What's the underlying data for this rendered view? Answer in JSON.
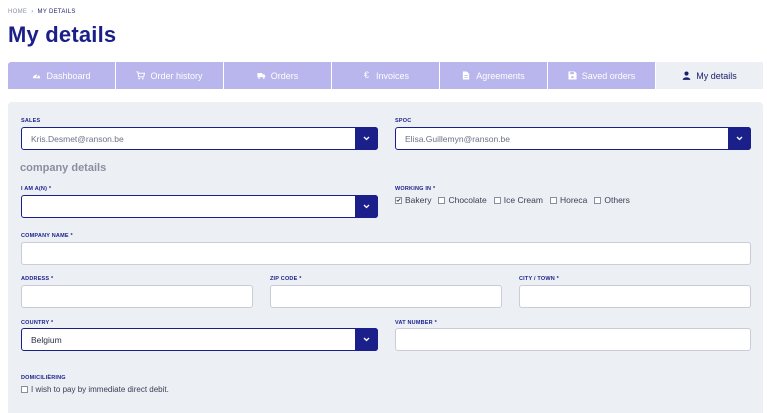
{
  "breadcrumb": {
    "home": "HOME",
    "separator": "›",
    "current": "MY DETAILS"
  },
  "page": {
    "title": "My details"
  },
  "tabs": [
    {
      "label": "Dashboard",
      "icon": "dashboard-icon"
    },
    {
      "label": "Order history",
      "icon": "cart-icon"
    },
    {
      "label": "Orders",
      "icon": "truck-icon"
    },
    {
      "label": "Invoices",
      "icon": "euro-icon"
    },
    {
      "label": "Agreements",
      "icon": "document-icon"
    },
    {
      "label": "Saved orders",
      "icon": "save-icon"
    },
    {
      "label": "My details",
      "icon": "user-icon",
      "active": true
    }
  ],
  "form": {
    "sales": {
      "label": "SALES",
      "value": "Kris.Desmet@ranson.be"
    },
    "spoc": {
      "label": "SPOC",
      "value": "Elisa.Guillemyn@ranson.be"
    },
    "section_title": "company details",
    "i_am": {
      "label": "I AM A(N) *",
      "value": ""
    },
    "working_in": {
      "label": "WORKING IN *",
      "options": [
        {
          "label": "Bakery",
          "checked": true
        },
        {
          "label": "Chocolate",
          "checked": false
        },
        {
          "label": "Ice Cream",
          "checked": false
        },
        {
          "label": "Horeca",
          "checked": false
        },
        {
          "label": "Others",
          "checked": false
        }
      ]
    },
    "company_name": {
      "label": "COMPANY NAME *",
      "value": ""
    },
    "address": {
      "label": "ADDRESS *",
      "value": ""
    },
    "zip_code": {
      "label": "ZIP CODE *",
      "value": ""
    },
    "city": {
      "label": "CITY / TOWN *",
      "value": ""
    },
    "country": {
      "label": "COUNTRY *",
      "value": "Belgium"
    },
    "vat_number": {
      "label": "VAT NUMBER *",
      "value": ""
    },
    "domiciliering": {
      "label": "DOMICILIËRING",
      "option": "I wish to pay by immediate direct debit.",
      "checked": false
    }
  },
  "colors": {
    "primary": "#1a1f8a",
    "tab_bg": "#b8b6ec",
    "panel_bg": "#eceff3"
  }
}
